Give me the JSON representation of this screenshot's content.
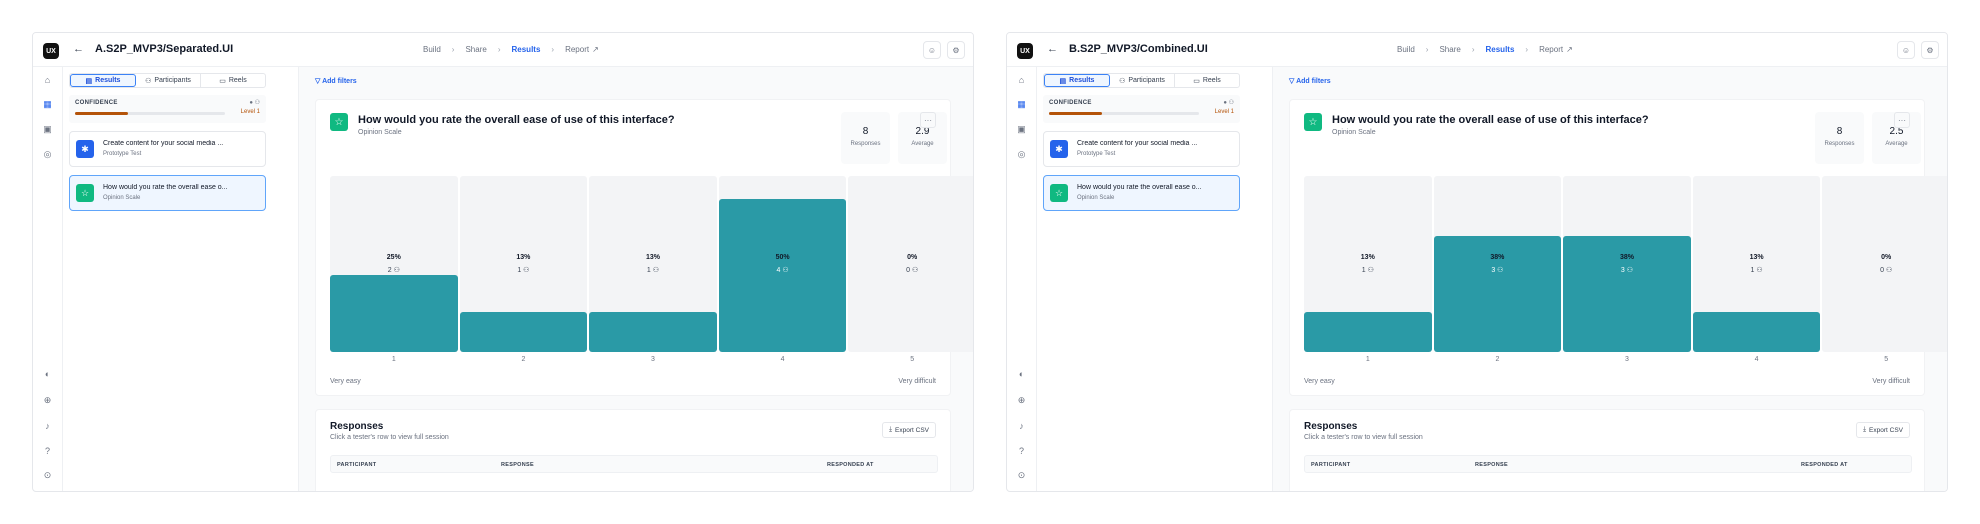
{
  "common": {
    "logo": "UX",
    "back_icon": "←",
    "nav": [
      "Build",
      "Share",
      "Results",
      "Report"
    ],
    "nav_active": "Results",
    "report_icon": "↗",
    "tabs": [
      "Results",
      "Participants",
      "Reels"
    ],
    "confidence_label": "CONFIDENCE",
    "confidence_level": "Level 1",
    "confidence_color": "#b45309",
    "add_filters": "Add filters",
    "accent": "#2563eb",
    "bar_color": "#2a9aa6",
    "cards": [
      {
        "title": "Create content for your social media ...",
        "subtitle": "Prototype Test",
        "icon": "prototype-icon",
        "icon_color": "#2563eb"
      },
      {
        "title": "How would you rate the overall ease o...",
        "subtitle": "Opinion Scale",
        "icon": "star-icon",
        "icon_color": "#10b981"
      }
    ],
    "question": {
      "title": "How would you rate the overall ease of use of this interface?",
      "subtitle": "Opinion Scale",
      "responses_label": "Responses",
      "average_label": "Average"
    },
    "scale_labels": [
      "1",
      "2",
      "3",
      "4",
      "5"
    ],
    "scale_left": "Very easy",
    "scale_right": "Very difficult",
    "responses_section": {
      "title": "Responses",
      "subtitle": "Click a tester's row to view full session",
      "export": "Export CSV",
      "columns": [
        "PARTICIPANT",
        "RESPONSE",
        "RESPONDED AT"
      ]
    }
  },
  "panels": [
    {
      "title": "A.S2P_MVP3/Separated.UI",
      "confidence_progress": 0.35,
      "responses": "8",
      "average": "2.9",
      "chart_data": {
        "type": "bar",
        "categories": [
          "1",
          "2",
          "3",
          "4",
          "5"
        ],
        "percent_labels": [
          "25%",
          "13%",
          "13%",
          "50%",
          "0%"
        ],
        "values": [
          2,
          1,
          1,
          4,
          0
        ],
        "percent": [
          25,
          13,
          13,
          50,
          0
        ],
        "ylim": [
          0,
          8
        ]
      }
    },
    {
      "title": "B.S2P_MVP3/Combined.UI",
      "confidence_progress": 0.35,
      "responses": "8",
      "average": "2.5",
      "chart_data": {
        "type": "bar",
        "categories": [
          "1",
          "2",
          "3",
          "4",
          "5"
        ],
        "percent_labels": [
          "13%",
          "38%",
          "38%",
          "13%",
          "0%"
        ],
        "values": [
          1,
          3,
          3,
          1,
          0
        ],
        "percent": [
          13,
          38,
          38,
          13,
          0
        ],
        "ylim": [
          0,
          8
        ]
      }
    }
  ]
}
